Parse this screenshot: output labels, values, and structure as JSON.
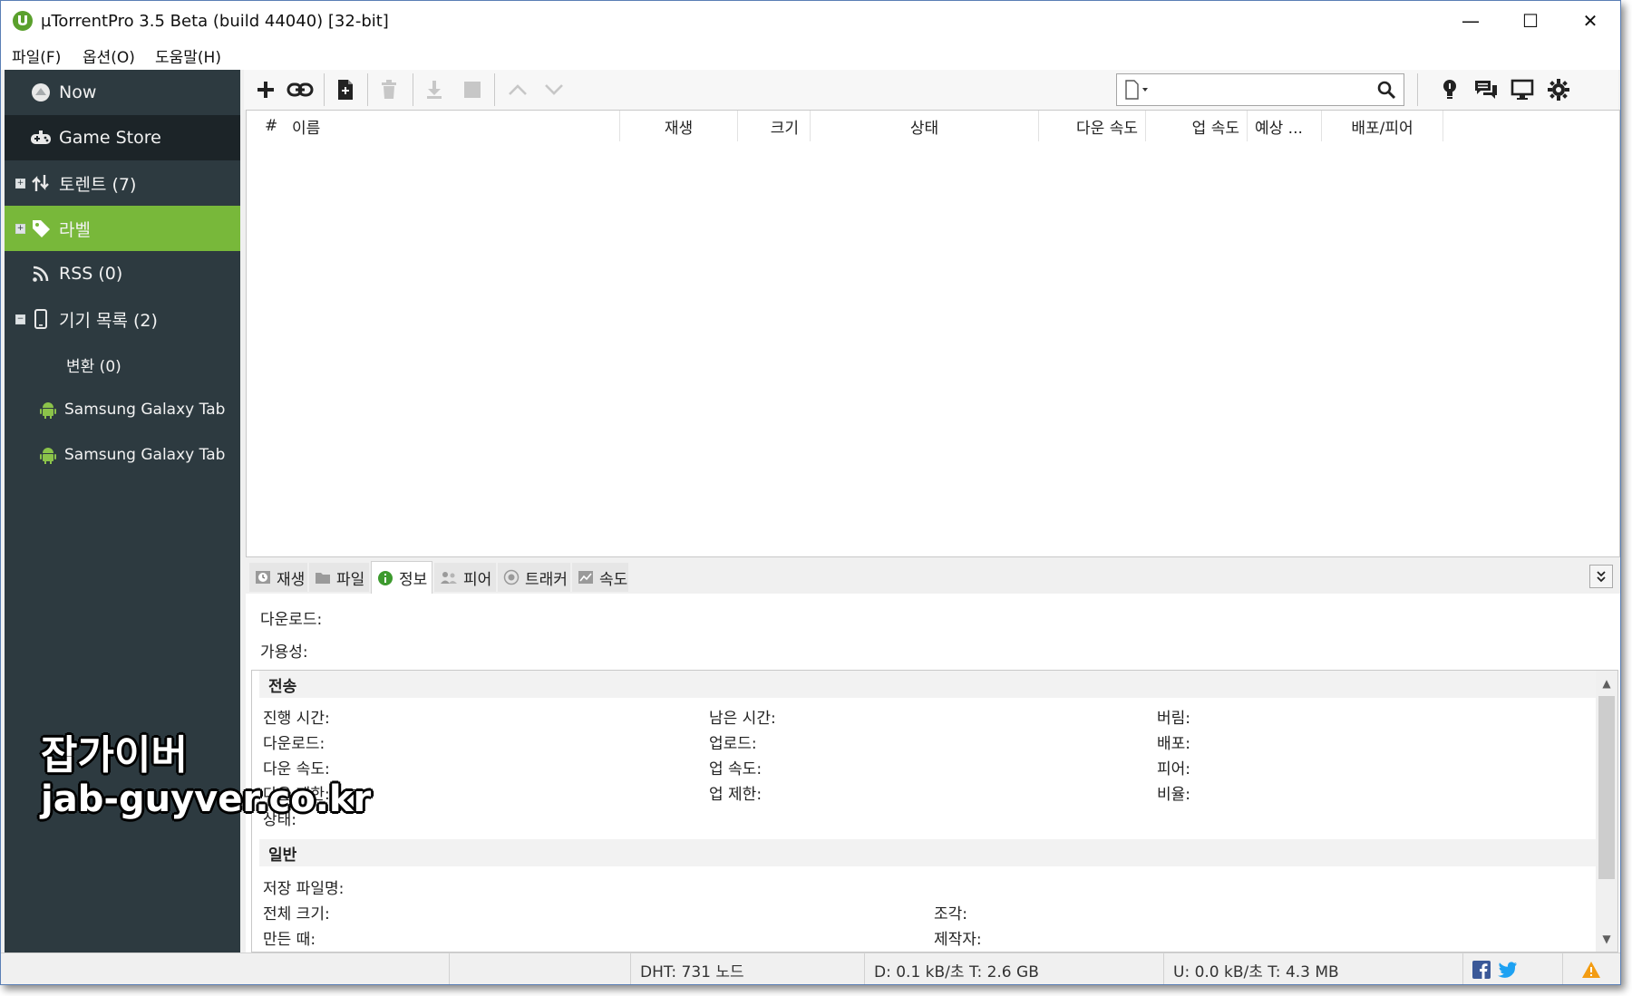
{
  "window": {
    "title": "µTorrentPro 3.5 Beta (build 44040) [32-bit]",
    "min_glyph": "—",
    "max_glyph": "☐",
    "close_glyph": "✕"
  },
  "menu": [
    "파일(F)",
    "옵션(O)",
    "도움말(H)"
  ],
  "sidebar": {
    "items": [
      {
        "label": "Now",
        "icon": "now-icon"
      },
      {
        "label": "Game Store",
        "icon": "gamepad-icon"
      },
      {
        "label": "토렌트 (7)",
        "icon": "transfer-arrows-icon"
      },
      {
        "label": "라벨",
        "icon": "tag-icon"
      },
      {
        "label": "RSS (0)",
        "icon": "rss-icon"
      },
      {
        "label": "기기 목록 (2)",
        "icon": "phone-icon"
      },
      {
        "label": "변환 (0)",
        "icon": ""
      },
      {
        "label": "Samsung Galaxy Tab",
        "icon": "android-icon"
      },
      {
        "label": "Samsung Galaxy Tab",
        "icon": "android-icon"
      }
    ],
    "accent": "#78b83a"
  },
  "toolbar": {
    "buttons": [
      "add-torrent",
      "add-url",
      "create-torrent",
      "remove",
      "start",
      "stop",
      "move-up",
      "move-down"
    ],
    "search_placeholder": "",
    "right_icons": [
      "lightbulb-icon",
      "chat-icon",
      "remote-icon",
      "settings-icon"
    ]
  },
  "columns": [
    "#",
    "이름",
    "재생",
    "크기",
    "상태",
    "다운 속도",
    "업 속도",
    "예상 ...",
    "배포/피어"
  ],
  "detail_tabs": [
    {
      "label": "재생",
      "icon": "clock-icon"
    },
    {
      "label": "파일",
      "icon": "folder-icon"
    },
    {
      "label": "정보",
      "icon": "info-icon",
      "active": true
    },
    {
      "label": "피어",
      "icon": "peers-icon"
    },
    {
      "label": "트래커",
      "icon": "tracker-icon"
    },
    {
      "label": "속도",
      "icon": "graph-icon"
    }
  ],
  "detail": {
    "downloaded": "다운로드:",
    "availability": "가용성:",
    "transfer_header": "전송",
    "transfer": {
      "col1": [
        "진행 시간:",
        "다운로드:",
        "다운 속도:",
        "다운 제한:",
        "상태:"
      ],
      "col2": [
        "남은 시간:",
        "업로드:",
        "업 속도:",
        "업 제한:"
      ],
      "col3": [
        "버림:",
        "배포:",
        "피어:",
        "비율:"
      ]
    },
    "general_header": "일반",
    "general": {
      "save_as": "저장 파일명:",
      "total_size": "전체 크기:",
      "created_on": "만든 때:",
      "pieces": "조각:",
      "created_by": "제작자:"
    }
  },
  "status": {
    "dht": "DHT: 731 노드",
    "download": "D: 0.1 kB/초 T: 2.6 GB",
    "upload": "U: 0.0 kB/초 T: 4.3 MB"
  },
  "watermark": {
    "line1": "잡가이버",
    "line2": "jab-guyver.co.kr"
  }
}
